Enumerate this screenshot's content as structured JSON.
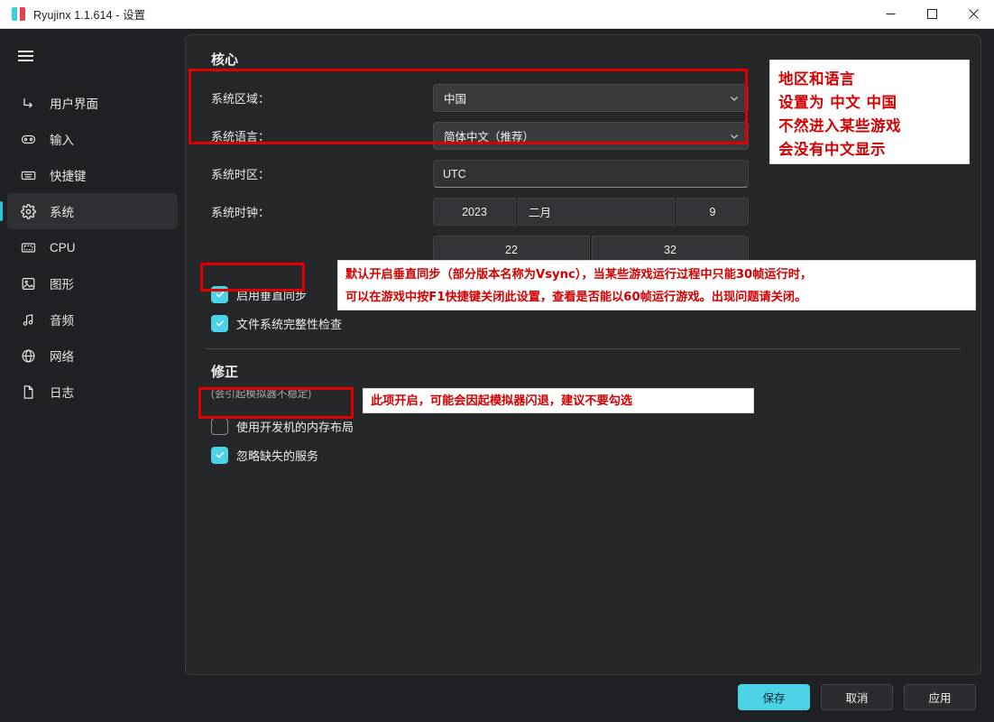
{
  "window": {
    "title": "Ryujinx 1.1.614 - 设置",
    "controls": {
      "minimize": "minimize-icon",
      "maximize": "maximize-icon",
      "close": "close-icon"
    }
  },
  "sidebar": {
    "menu_icon": "hamburger-icon",
    "items": [
      {
        "label": "用户界面",
        "icon": "ui-icon",
        "active": false
      },
      {
        "label": "输入",
        "icon": "gamepad-icon",
        "active": false
      },
      {
        "label": "快捷键",
        "icon": "keyboard-icon",
        "active": false
      },
      {
        "label": "系统",
        "icon": "gear-icon",
        "active": true
      },
      {
        "label": "CPU",
        "icon": "cpu-icon",
        "active": false
      },
      {
        "label": "图形",
        "icon": "image-icon",
        "active": false
      },
      {
        "label": "音频",
        "icon": "music-icon",
        "active": false
      },
      {
        "label": "网络",
        "icon": "globe-icon",
        "active": false
      },
      {
        "label": "日志",
        "icon": "file-icon",
        "active": false
      }
    ]
  },
  "core": {
    "section_title": "核心",
    "region": {
      "label": "系统区域：",
      "value": "中国"
    },
    "language": {
      "label": "系统语言：",
      "value": "简体中文（推荐）"
    },
    "timezone": {
      "label": "系统时区：",
      "value": "UTC"
    },
    "clock": {
      "label": "系统时钟：",
      "year": "2023",
      "month": "二月",
      "day": "9",
      "hour": "22",
      "minute": "32"
    },
    "checkboxes": [
      {
        "label": "启用垂直同步",
        "checked": true
      },
      {
        "label": "文件系统完整性检查",
        "checked": true
      }
    ]
  },
  "hacks": {
    "section_title": "修正",
    "section_subtitle": "(会引起模拟器不稳定)",
    "checkboxes": [
      {
        "label": "使用开发机的内存布局",
        "checked": false
      },
      {
        "label": "忽略缺失的服务",
        "checked": true
      }
    ]
  },
  "footer": {
    "save": "保存",
    "cancel": "取消",
    "apply": "应用"
  },
  "annotations": {
    "region_note": "地区和语言\n设置为 中文 中国\n不然进入某些游戏\n会没有中文显示",
    "vsync_note": "默认开启垂直同步（部分版本名称为Vsync），当某些游戏运行过程中只能30帧运行时，\n可以在游戏中按F1快捷键关闭此设置，查看是否能以60帧运行游戏。出现问题请关闭。",
    "devmem_note": "此项开启，可能会因起模拟器闪退，建议不要勾选"
  },
  "colors": {
    "accent": "#4cd2e6",
    "annotation_red": "#d40000",
    "panel_bg": "#262729",
    "window_bg": "#202124"
  }
}
